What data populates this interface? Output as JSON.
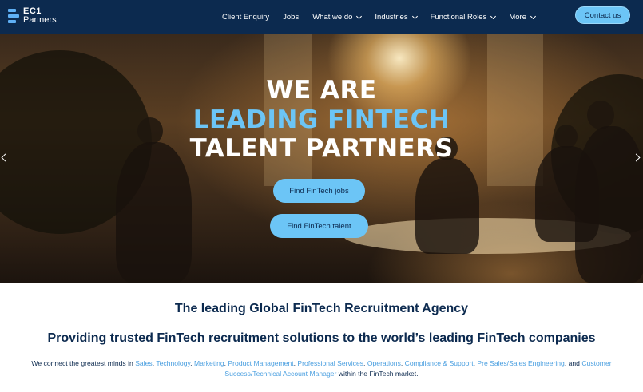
{
  "header": {
    "logo": {
      "line1": "EC1",
      "line2": "Partners"
    },
    "nav": [
      {
        "label": "Client Enquiry",
        "dropdown": false
      },
      {
        "label": "Jobs",
        "dropdown": false
      },
      {
        "label": "What we do",
        "dropdown": true
      },
      {
        "label": "Industries",
        "dropdown": true
      },
      {
        "label": "Functional Roles",
        "dropdown": true
      },
      {
        "label": "More",
        "dropdown": true
      }
    ],
    "contact_label": "Contact us"
  },
  "hero": {
    "title_line1": "WE ARE",
    "title_line2": "LEADING FINTECH",
    "title_line3": "TALENT PARTNERS",
    "jobs_button": "Find FinTech jobs",
    "talent_button": "Find FinTech talent"
  },
  "content": {
    "agency_heading": "The leading Global FinTech Recruitment Agency",
    "providing_heading": "Providing trusted FinTech recruitment solutions to the world’s leading FinTech companies",
    "desc_prefix": "We connect the greatest minds in ",
    "links": [
      "Sales",
      "Technology",
      "Marketing",
      "Product Management",
      "Professional Services",
      "Operations",
      "Compliance & Support",
      "Pre Sales/Sales Engineering",
      "Customer Success/Technical Account Manager"
    ],
    "sep": ", ",
    "and": ", and ",
    "desc_suffix": " within the FinTech market."
  },
  "colors": {
    "navy": "#0c2a4f",
    "accent": "#6cc5f6",
    "link": "#4a9fe0"
  }
}
